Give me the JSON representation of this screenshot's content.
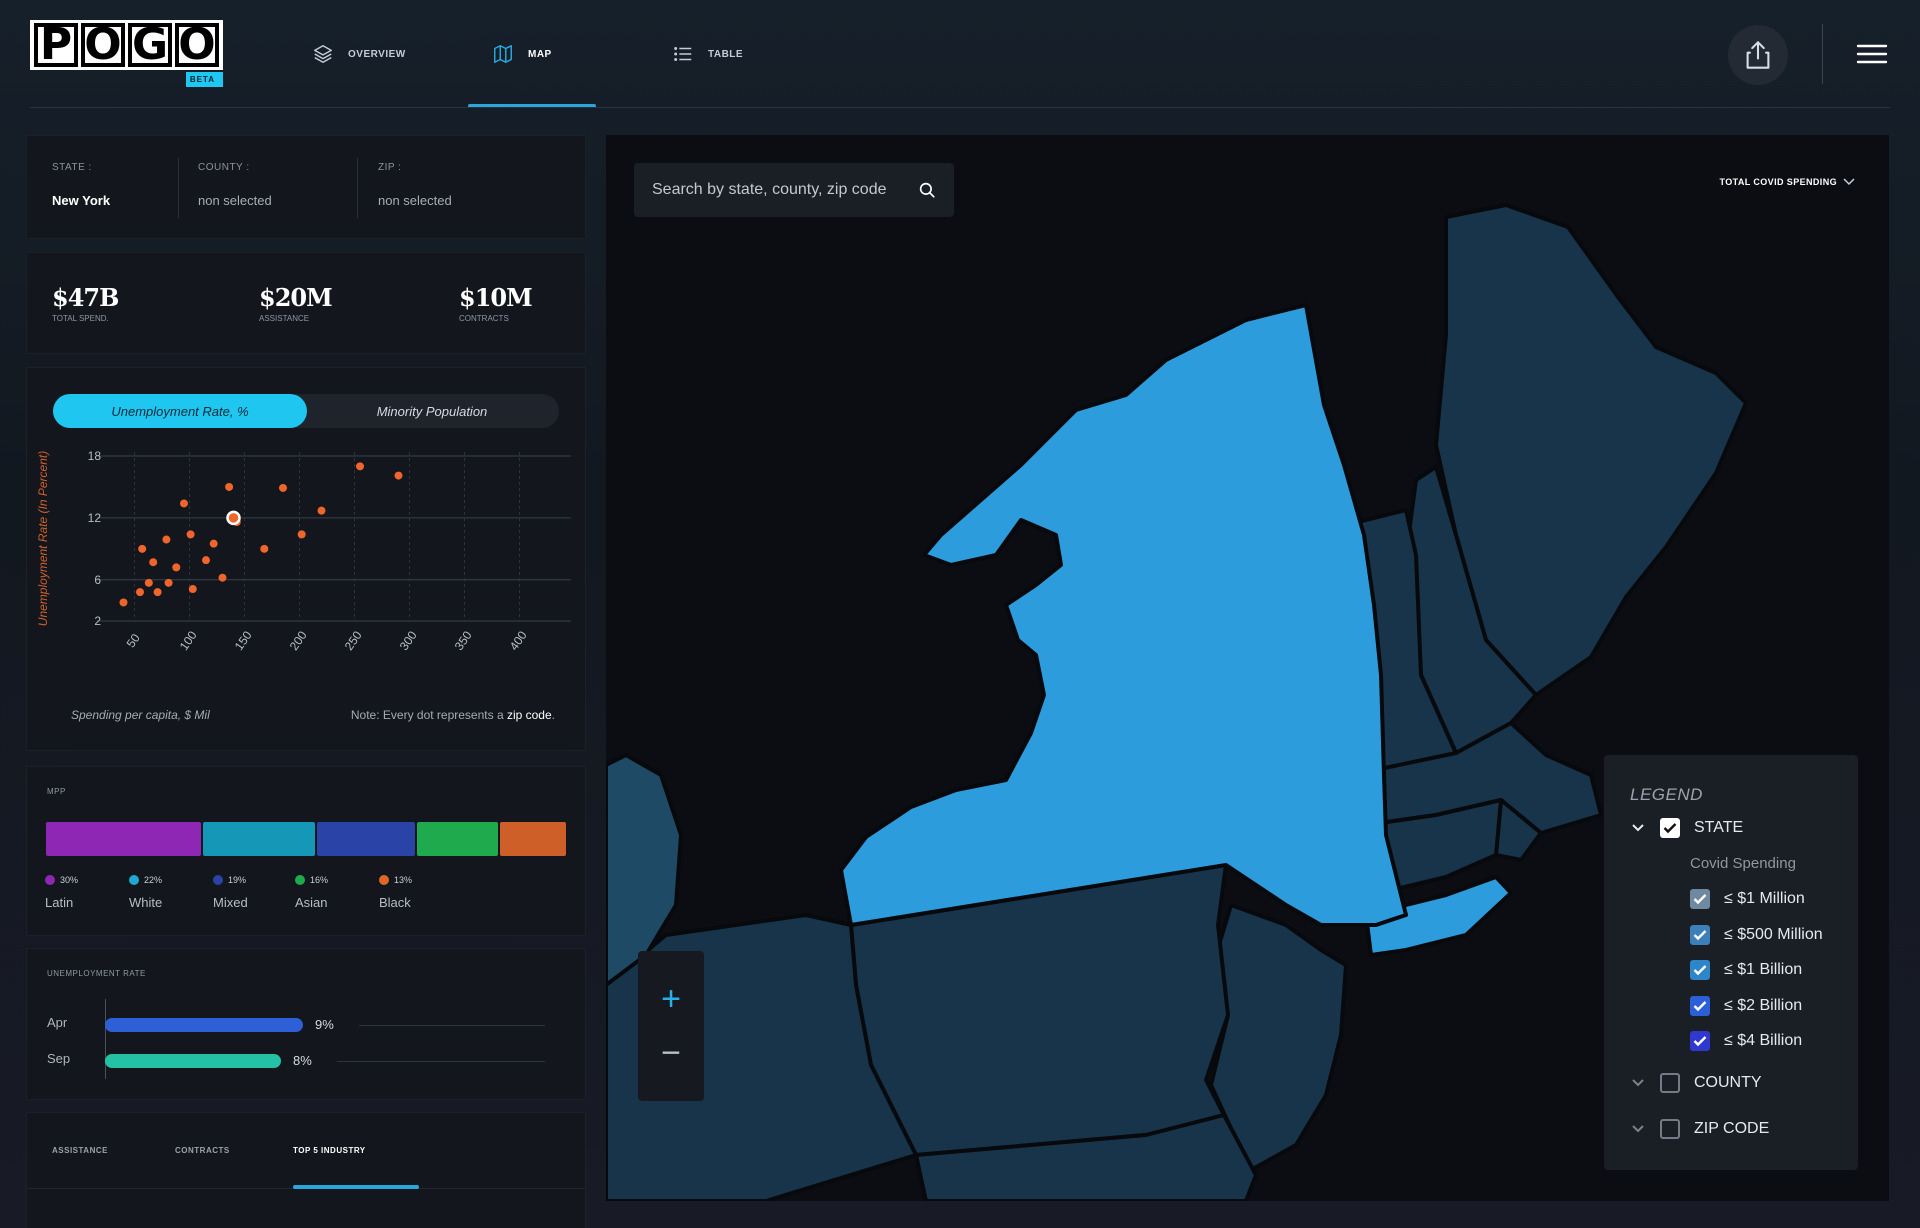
{
  "header": {
    "logo_letters": [
      "P",
      "O",
      "G",
      "O"
    ],
    "logo_badge": "BETA",
    "nav": [
      {
        "label": "OVERVIEW",
        "icon": "layers-icon"
      },
      {
        "label": "MAP",
        "icon": "map-icon",
        "active": true
      },
      {
        "label": "TABLE",
        "icon": "list-icon"
      }
    ]
  },
  "location": {
    "state_label": "STATE :",
    "state_value": "New York",
    "county_label": "COUNTY :",
    "county_value": "non selected",
    "zip_label": "ZIP :",
    "zip_value": "non selected"
  },
  "stats": [
    {
      "value": "$47B",
      "label": "TOTAL SPEND."
    },
    {
      "value": "$20M",
      "label": "ASSISTANCE"
    },
    {
      "value": "$10M",
      "label": "CONTRACTS"
    }
  ],
  "chart_toggle": {
    "active": "Unemployment Rate, %",
    "inactive": "Minority Population"
  },
  "chart_data": {
    "type": "scatter",
    "ylabel": "Unemployment Rate (In Percent)",
    "xlabel": "Spending per capita, $ Mil",
    "note_prefix": "Note: Every dot represents a ",
    "note_emph": "zip code",
    "note_suffix": ".",
    "x_ticks": [
      "50",
      "100",
      "150",
      "200",
      "250",
      "300",
      "350",
      "400"
    ],
    "y_ticks": [
      "18",
      "12",
      "6",
      "2"
    ],
    "xlim": [
      25,
      425
    ],
    "ylim": [
      2,
      18
    ],
    "y_tick_values": [
      18,
      12,
      6,
      2
    ],
    "x_tick_values": [
      50,
      100,
      150,
      200,
      250,
      300,
      350,
      400
    ],
    "points": [
      [
        40,
        3.8
      ],
      [
        55,
        4.8
      ],
      [
        57,
        9.0
      ],
      [
        63,
        5.7
      ],
      [
        67,
        7.7
      ],
      [
        71,
        4.8
      ],
      [
        79,
        9.9
      ],
      [
        81,
        5.7
      ],
      [
        88,
        7.2
      ],
      [
        95,
        13.4
      ],
      [
        101,
        10.4
      ],
      [
        103,
        5.1
      ],
      [
        115,
        7.9
      ],
      [
        122,
        9.5
      ],
      [
        130,
        6.2
      ],
      [
        136,
        15.0
      ],
      [
        143,
        11.6
      ],
      [
        168,
        9.0
      ],
      [
        185,
        14.9
      ],
      [
        202,
        10.4
      ],
      [
        220,
        12.7
      ],
      [
        255,
        17.0
      ],
      [
        290,
        16.1
      ]
    ],
    "highlight": [
      140,
      12.0
    ],
    "dot_color": "#f0652c"
  },
  "mpp": {
    "title": "MPP",
    "segments": [
      {
        "name": "Latin",
        "pct": "30%",
        "share": 0.3,
        "color": "#8e27b4"
      },
      {
        "name": "White",
        "pct": "22%",
        "share": 0.22,
        "color": "#1597b8"
      },
      {
        "name": "Mixed",
        "pct": "19%",
        "share": 0.19,
        "color": "#2a43a6"
      },
      {
        "name": "Asian",
        "pct": "16%",
        "share": 0.16,
        "color": "#1faa4d"
      },
      {
        "name": "Black",
        "pct": "13%",
        "share": 0.13,
        "color": "#cf5f28"
      }
    ]
  },
  "unemployment": {
    "title": "UNEMPLOYMENT RATE",
    "rows": [
      {
        "label": "Apr",
        "value": "9%",
        "pct": 9,
        "color": "#2d5fd6"
      },
      {
        "label": "Sep",
        "value": "8%",
        "pct": 8,
        "color": "#23c2a4"
      }
    ]
  },
  "bottom_tabs": [
    {
      "label": "ASSISTANCE"
    },
    {
      "label": "CONTRACTS"
    },
    {
      "label": "TOP 5 INDUSTRY",
      "active": true
    }
  ],
  "map": {
    "search_placeholder": "Search by state, county, zip code",
    "metric": "TOTAL COVID SPENDING",
    "zoom_in": "+",
    "zoom_out": "−",
    "selected_state_color": "#2d9cdc",
    "state_color": "#17344a"
  },
  "legend": {
    "title": "LEGEND",
    "state_label": "STATE",
    "sub_title": "Covid Spending",
    "items": [
      "≤ $1 Million",
      "≤ $500 Million",
      "≤ $1 Billion",
      "≤ $2 Billion",
      "≤ $4 Billion"
    ],
    "item_colors": [
      "#6f8aa0",
      "#3d7fb8",
      "#2e86c9",
      "#2a5fd8",
      "#2f39d0"
    ],
    "county_label": "COUNTY",
    "zip_label": "ZIP CODE"
  }
}
